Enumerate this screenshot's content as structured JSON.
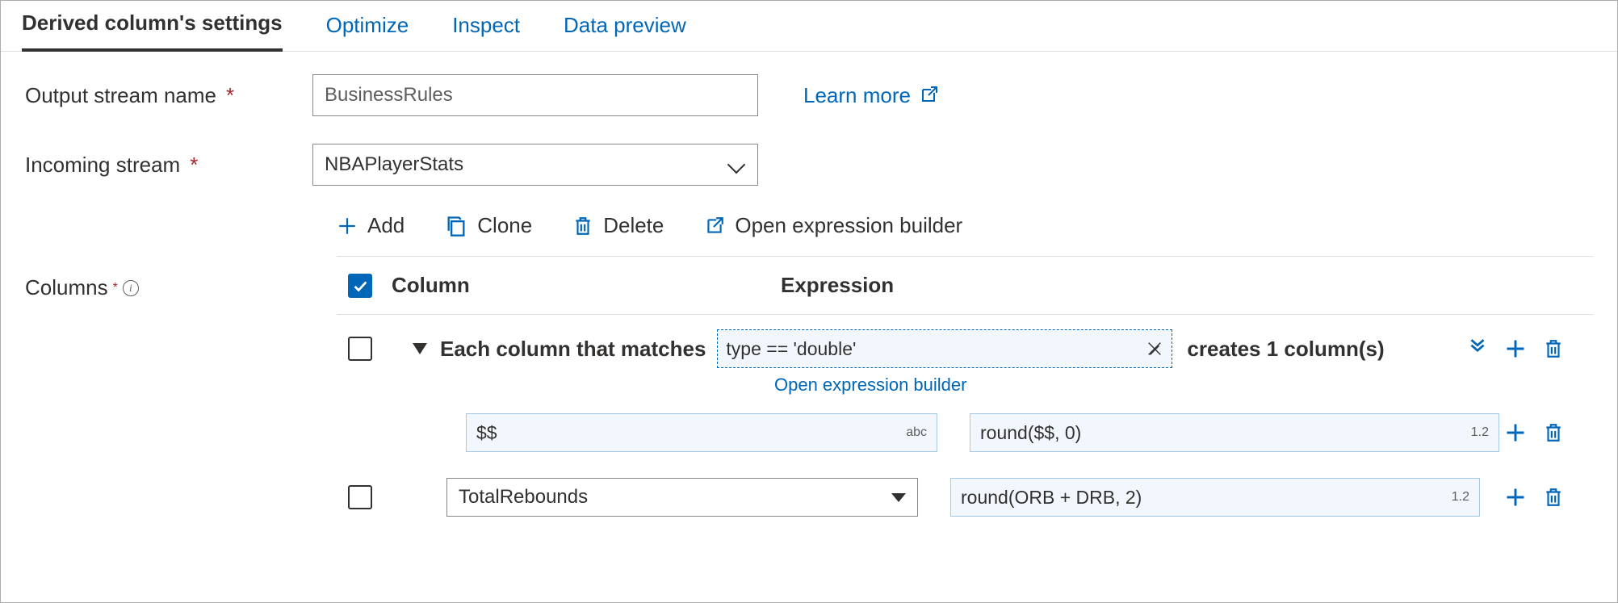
{
  "tabs": {
    "settings": "Derived column's settings",
    "optimize": "Optimize",
    "inspect": "Inspect",
    "preview": "Data preview"
  },
  "labels": {
    "output_stream": "Output stream name",
    "incoming_stream": "Incoming stream",
    "columns": "Columns",
    "learn_more": "Learn more"
  },
  "fields": {
    "output_stream_value": "BusinessRules",
    "incoming_stream_value": "NBAPlayerStats"
  },
  "toolbar": {
    "add": "Add",
    "clone": "Clone",
    "delete": "Delete",
    "open_builder": "Open expression builder"
  },
  "table": {
    "col_header": "Column",
    "exp_header": "Expression",
    "pattern_prefix": "Each column that matches",
    "pattern_expr": "type == 'double'",
    "pattern_suffix": "creates 1 column(s)",
    "open_builder_link": "Open expression builder",
    "pattern_col_name": "$$",
    "pattern_col_hint": "abc",
    "pattern_exp_value": "round($$, 0)",
    "pattern_exp_hint": "1.2",
    "row2_col": "TotalRebounds",
    "row2_exp": "round(ORB + DRB, 2)",
    "row2_exp_hint": "1.2"
  }
}
